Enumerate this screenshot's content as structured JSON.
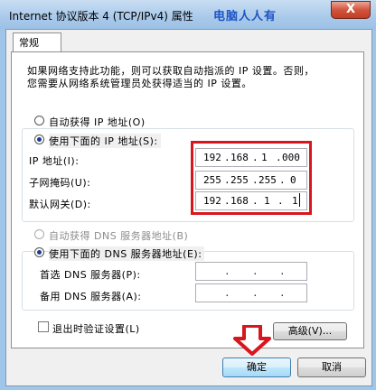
{
  "window": {
    "title": "Internet 协议版本 4 (TCP/IPv4) 属性",
    "watermark": "电脑人人有",
    "close_glyph": "X"
  },
  "tabs": [
    {
      "label": "常规",
      "active": true
    }
  ],
  "description": {
    "line1": "如果网络支持此功能，则可以获取自动指派的 IP 设置。否则，",
    "line2": "您需要从网络系统管理员处获得适当的 IP 设置。"
  },
  "ip_section": {
    "auto_radio": {
      "label": "自动获得 IP 地址(O)",
      "checked": false
    },
    "manual_radio": {
      "label": "使用下面的 IP 地址(S):",
      "checked": true
    },
    "fields": [
      {
        "label": "IP 地址(I):",
        "octets": [
          "192",
          "168",
          "1",
          "000"
        ]
      },
      {
        "label": "子网掩码(U):",
        "octets": [
          "255",
          "255",
          "255",
          "0"
        ]
      },
      {
        "label": "默认网关(D):",
        "octets": [
          "192",
          "168",
          "1",
          "1"
        ]
      }
    ]
  },
  "dns_section": {
    "auto_radio": {
      "label": "自动获得 DNS 服务器地址(B)",
      "checked": false,
      "disabled": true
    },
    "manual_radio": {
      "label": "使用下面的 DNS 服务器地址(E):",
      "checked": true
    },
    "fields": [
      {
        "label": "首选 DNS 服务器(P):",
        "octets": [
          "",
          "",
          "",
          ""
        ]
      },
      {
        "label": "备用 DNS 服务器(A):",
        "octets": [
          "",
          "",
          "",
          ""
        ]
      }
    ]
  },
  "validate_checkbox": {
    "label": "退出时验证设置(L)",
    "checked": false
  },
  "buttons": {
    "advanced": "高级(V)...",
    "ok": "确定",
    "cancel": "取消"
  },
  "colors": {
    "highlight_box": "#d8161e",
    "arrow": "#d8161e"
  }
}
